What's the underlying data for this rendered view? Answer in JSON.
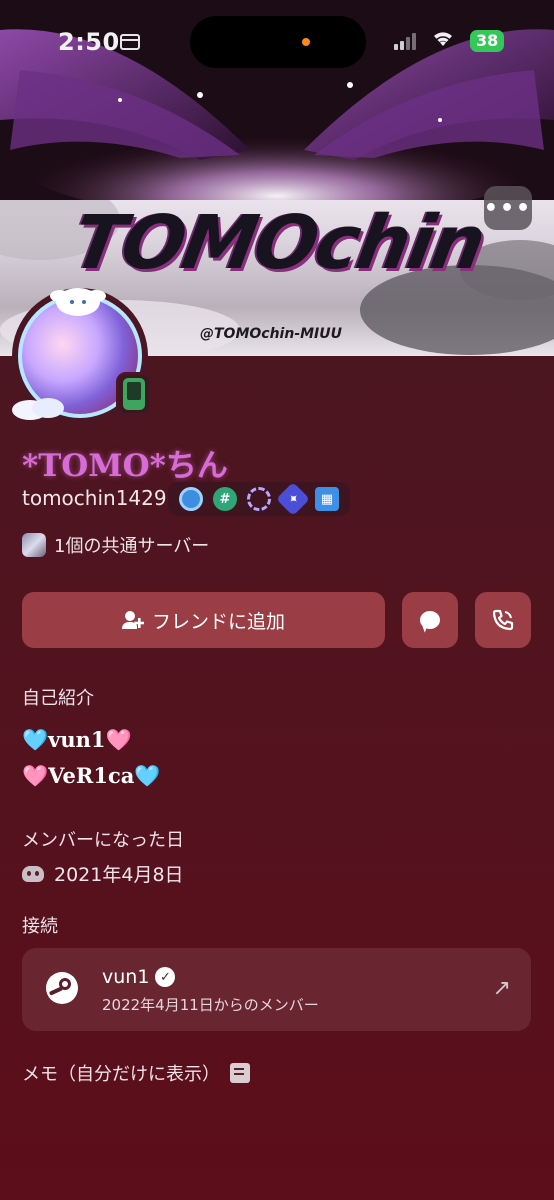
{
  "status_bar": {
    "time": "2:50",
    "battery": "38"
  },
  "banner": {
    "title": "TOMOchin",
    "handle": "@TOMOchin-MIUU",
    "more_label": "•••"
  },
  "profile": {
    "display_name": "*TOMO*ちん",
    "username": "tomochin1429",
    "badges": [
      "nitro-badge",
      "hypesquad-badge",
      "boost-badge",
      "quest-badge",
      "gift-badge"
    ],
    "mutual_servers": "1個の共通サーバー"
  },
  "actions": {
    "add_friend_label": "フレンドに追加"
  },
  "about": {
    "title": "自己紹介",
    "lines": [
      "🩵vun1🩷",
      "🩷VeR1ca🩵"
    ]
  },
  "member_since": {
    "title": "メンバーになった日",
    "date": "2021年4月8日"
  },
  "connections": {
    "title": "接続",
    "items": [
      {
        "name": "vun1",
        "subtitle": "2022年4月11日からのメンバー",
        "service": "steam-icon"
      }
    ]
  },
  "memo": {
    "label": "メモ（自分だけに表示）"
  },
  "colors": {
    "display_name": "#d86cd6",
    "button": "#9b3d44",
    "background": "#52131f"
  }
}
